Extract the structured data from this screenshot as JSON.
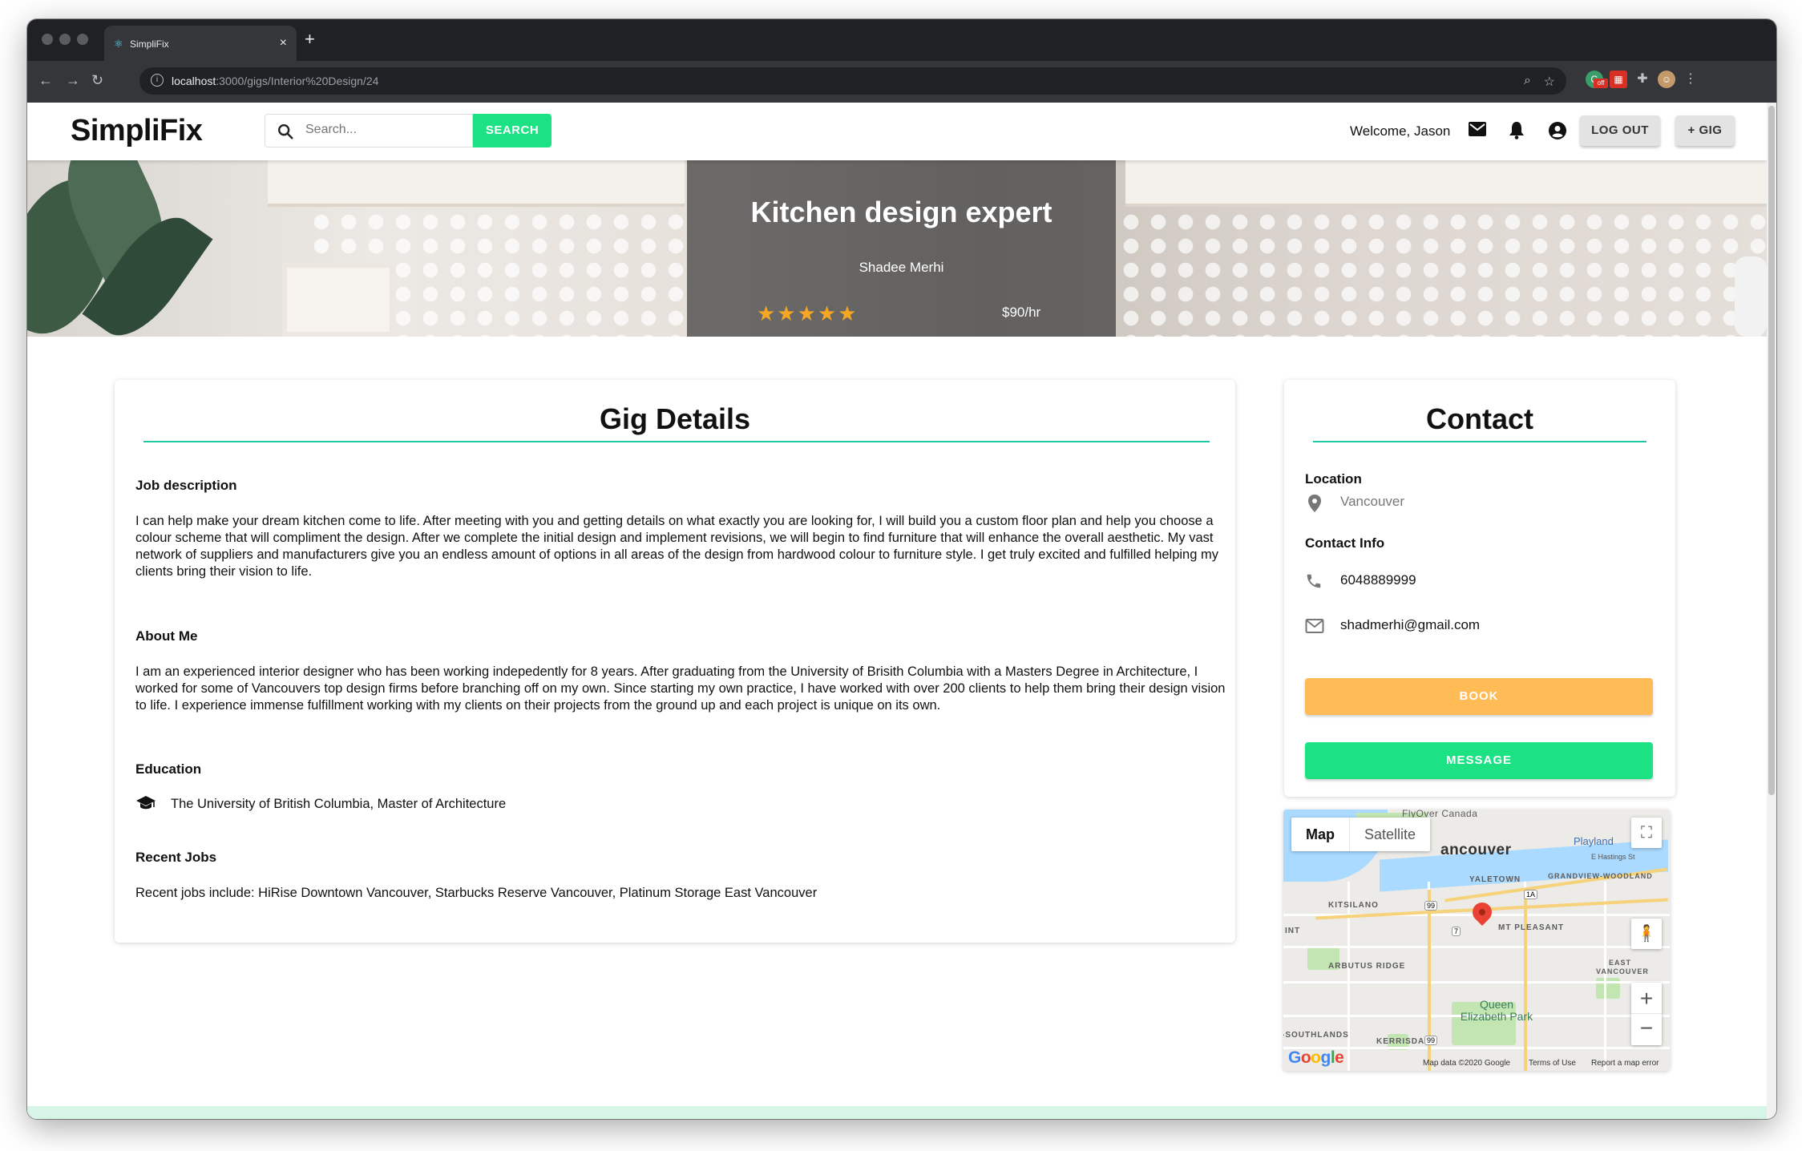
{
  "browser": {
    "tab_title": "SimpliFix",
    "url_host": "localhost",
    "url_path": ":3000/gigs/Interior%20Design/24",
    "new_tab": "+",
    "tab_close": "×",
    "ext_off_badge": "off"
  },
  "navbar": {
    "logo": "SimpliFix",
    "search_placeholder": "Search...",
    "search_button": "SEARCH",
    "welcome": "Welcome, Jason",
    "logout_button": "LOG OUT",
    "gig_button": "+ GIG"
  },
  "hero": {
    "title": "Kitchen design expert",
    "artist": "Shadee Merhi",
    "rating": 5,
    "stars": "★★★★★",
    "rate": "$90/hr"
  },
  "gig_details": {
    "title": "Gig Details",
    "job_description_label": "Job description",
    "job_description": "I can help make your dream kitchen come to life. After meeting with you and getting details on what exactly you are looking for, I will build you a custom floor plan and help you choose a colour scheme that will compliment the design. After we complete the initial design and implement revisions, we will begin to find furniture that will enhance the overall aesthetic. My vast network of suppliers and manufacturers give you an endless amount of options in all areas of the design from hardwood colour to furniture style. I get truly excited and fulfilled helping my clients bring their vision to life.",
    "about_label": "About Me",
    "about": "I am an experienced interior designer who has been working indepedently for 8 years. After graduating from the University of Brisith Columbia with a Masters Degree in Architecture, I worked for some of Vancouvers top design firms before branching off on my own. Since starting my own practice, I have worked with over 200 clients to help them bring their design vision to life. I experience immense fulfillment working with my clients on their projects from the ground up and each project is unique on its own.",
    "education_label": "Education",
    "education": "The University of British Columbia, Master of Architecture",
    "recent_jobs_label": "Recent Jobs",
    "recent_jobs": "Recent jobs include: HiRise Downtown Vancouver, Starbucks Reserve Vancouver, Platinum Storage East Vancouver"
  },
  "contact": {
    "title": "Contact",
    "location_label": "Location",
    "location": "Vancouver",
    "contact_info_label": "Contact Info",
    "phone": "6048889999",
    "email": "shadmerhi@gmail.com",
    "book_button": "BOOK",
    "message_button": "MESSAGE"
  },
  "map": {
    "map_tab": "Map",
    "satellite_tab": "Satellite",
    "labels": [
      "FlyOver Canada",
      "ancouver",
      "Playland",
      "E Hastings St",
      "YALETOWN",
      "GRANDVIEW-WOODLAND",
      "KITSILANO",
      "MT PLEASANT",
      "INT",
      "ARBUTUS RIDGE",
      "EAST VANCOUVER",
      "Queen Elizabeth Park",
      "-SOUTHLANDS",
      "KERRISDALE"
    ],
    "shields": [
      "99",
      "1A",
      "7",
      "99",
      "99"
    ],
    "zoom_in": "+",
    "zoom_out": "−",
    "fullscreen": "⛶",
    "pegman": "🧍",
    "google": "Google",
    "attribution": "Map data ©2020 Google",
    "terms": "Terms of Use",
    "report": "Report a map error"
  },
  "colors": {
    "accent_green": "#1de284",
    "book_orange": "#ffbb55",
    "rule_teal": "#1ec9a0",
    "star_gold": "#f5a623",
    "footer_mint": "#d6f5e6"
  }
}
